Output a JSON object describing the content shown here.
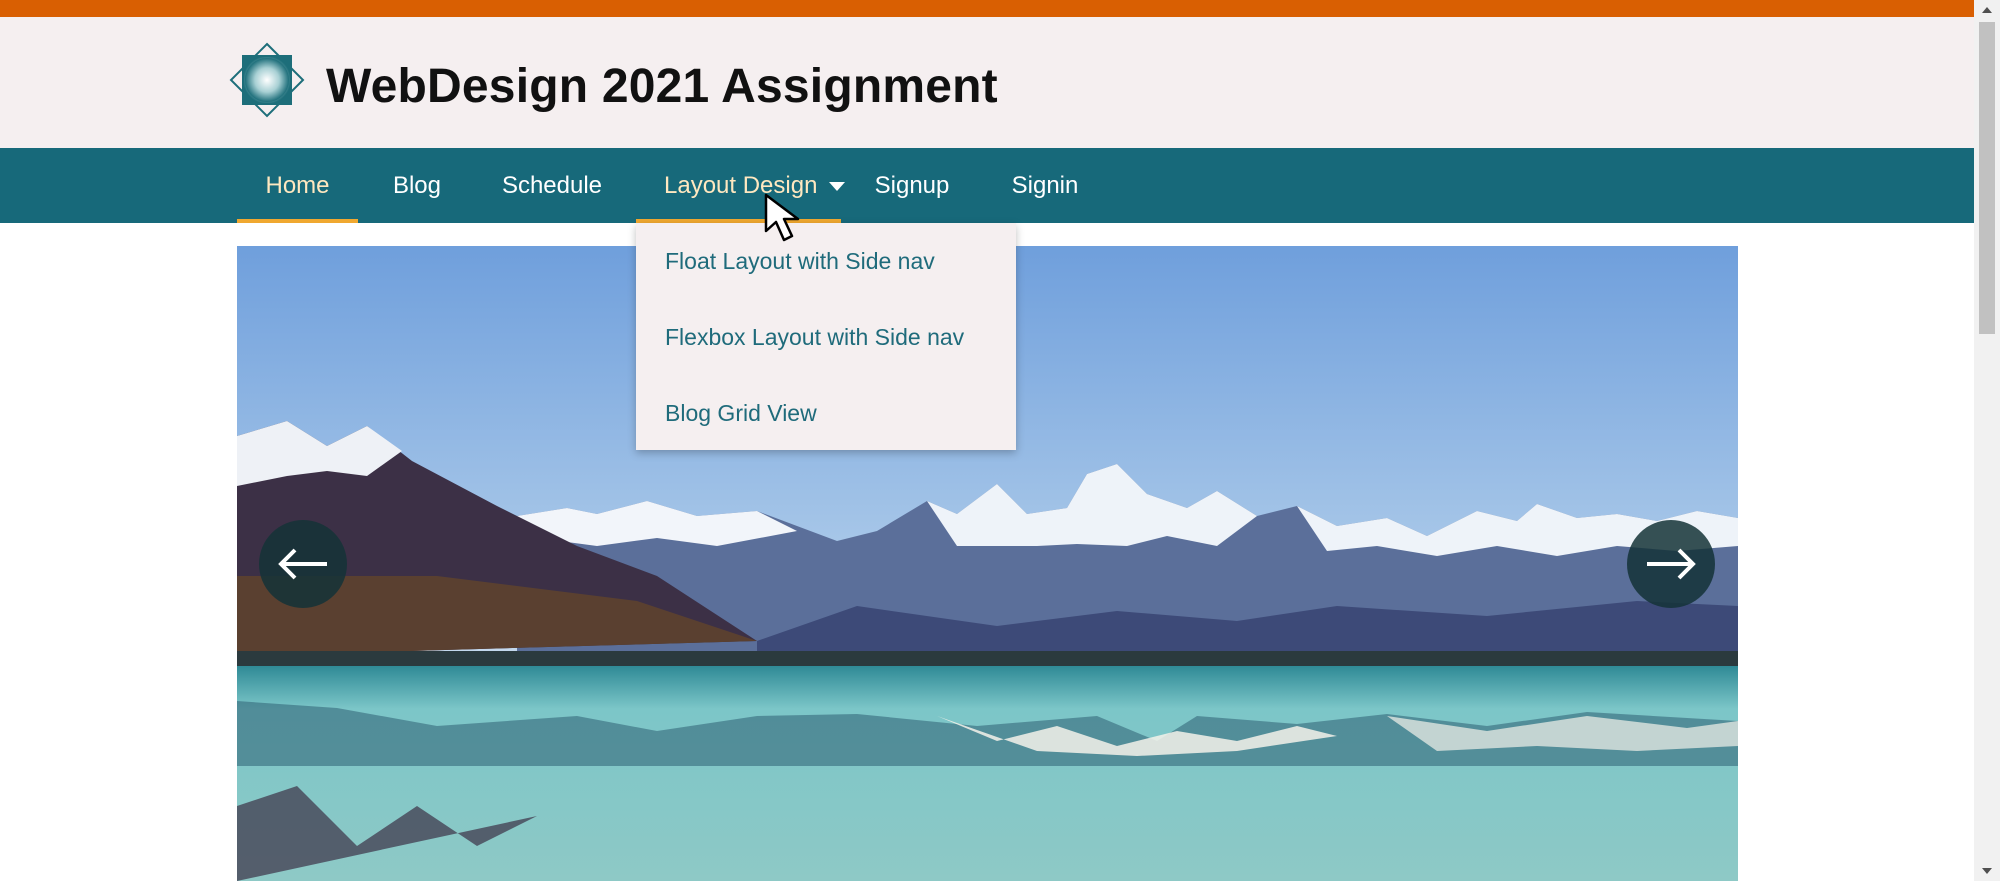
{
  "header": {
    "title": "WebDesign 2021 Assignment",
    "logo_icon": "diamond-logo-icon"
  },
  "nav": {
    "items": [
      {
        "label": "Home",
        "active": true
      },
      {
        "label": "Blog",
        "active": false
      },
      {
        "label": "Schedule",
        "active": false
      },
      {
        "label": "Layout Design",
        "active": true,
        "has_dropdown": true
      },
      {
        "label": "Signup",
        "active": false
      },
      {
        "label": "Signin",
        "active": false
      }
    ]
  },
  "dropdown": {
    "items": [
      {
        "label": "Float Layout with Side nav"
      },
      {
        "label": "Flexbox Layout with Side nav"
      },
      {
        "label": "Blog Grid View"
      }
    ]
  },
  "slideshow": {
    "image": "mountain-lake-landscape",
    "prev_icon": "arrow-left-icon",
    "next_icon": "arrow-right-icon"
  },
  "colors": {
    "accent_top": "#d95f02",
    "header_bg": "#f5eff0",
    "nav_bg": "#17697a",
    "nav_active_underline": "#f0a830",
    "dropdown_link": "#1f6b7b"
  }
}
